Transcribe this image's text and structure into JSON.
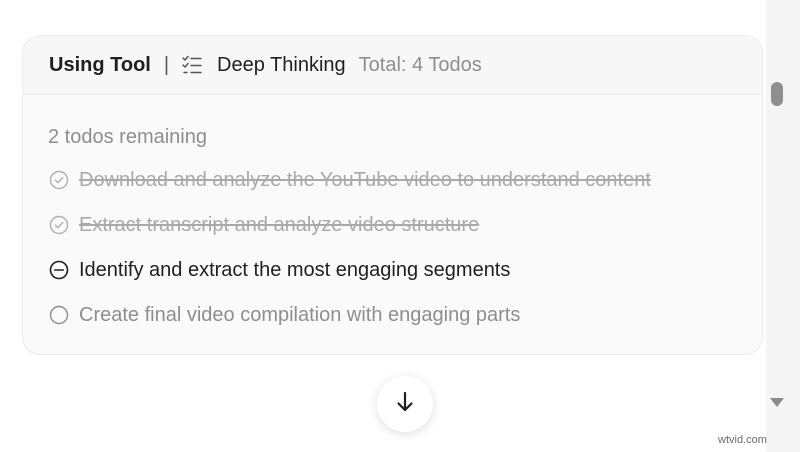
{
  "header": {
    "status": "Using Tool",
    "separator": "|",
    "tool_icon": "checklist-icon",
    "tool_name": "Deep Thinking",
    "total": "Total: 4 Todos"
  },
  "summary": {
    "remaining": "2 todos remaining"
  },
  "todos": [
    {
      "text": "Download and analyze the YouTube video to understand content",
      "status": "completed",
      "icon": "check-circle-icon"
    },
    {
      "text": "Extract transcript and analyze video structure",
      "status": "completed",
      "icon": "check-circle-icon"
    },
    {
      "text": "Identify and extract the most engaging segments",
      "status": "in-progress",
      "icon": "minus-circle-icon"
    },
    {
      "text": "Create final video compilation with engaging parts",
      "status": "pending",
      "icon": "empty-circle-icon"
    }
  ],
  "scroll_button": {
    "icon": "arrow-down-icon"
  },
  "watermark": "wtvid.com",
  "colors": {
    "primary_text": "#1f1f1f",
    "muted_text": "#8e8e8e",
    "completed_text": "#a9a9a9",
    "card_bg": "#fafafa",
    "border": "#ececec"
  }
}
